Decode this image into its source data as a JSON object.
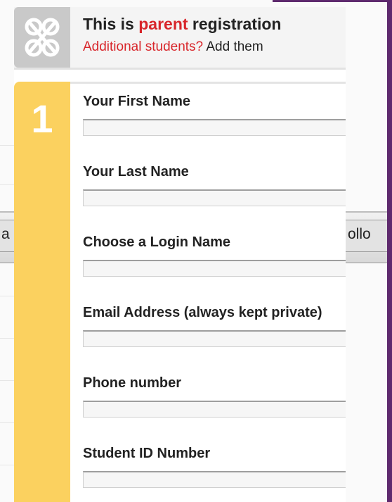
{
  "background": {
    "left_tab_text": "a",
    "right_tab_text": "ollo"
  },
  "header": {
    "line1_prefix": "This is ",
    "line1_highlight": "parent",
    "line1_suffix": " registration",
    "line2_link": "Additional students?",
    "line2_rest": " Add them"
  },
  "step": {
    "number": "1"
  },
  "fields": [
    {
      "label": "Your First Name",
      "value": ""
    },
    {
      "label": "Your Last Name",
      "value": ""
    },
    {
      "label": "Choose a Login Name",
      "value": ""
    },
    {
      "label": "Email Address (always kept private)",
      "value": ""
    },
    {
      "label": "Phone number",
      "value": ""
    },
    {
      "label": "Student ID Number",
      "value": ""
    }
  ],
  "colors": {
    "accent_red": "#d8262b",
    "step_yellow": "#fbd15f",
    "frame_purple": "#5e2a6e"
  }
}
